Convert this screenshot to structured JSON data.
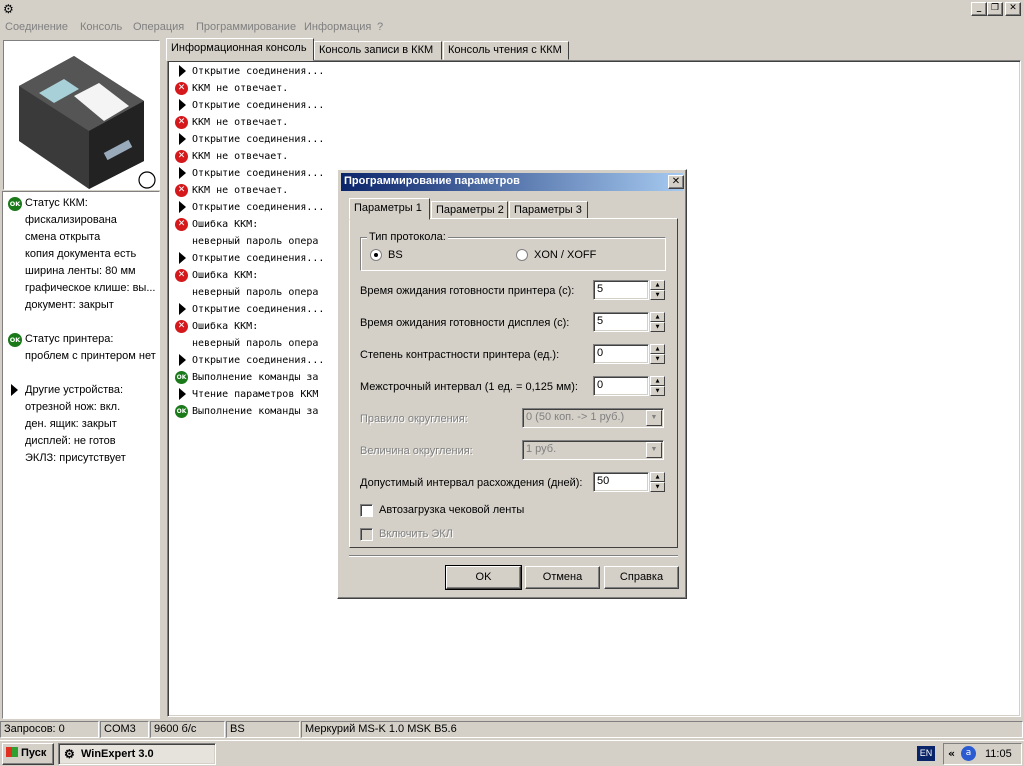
{
  "app": {
    "task_title": "WinExpert 3.0",
    "menu": [
      "Соединение",
      "Консоль",
      "Операция",
      "Программирование",
      "Информация",
      "?"
    ]
  },
  "tabs": [
    {
      "label": "Информационная консоль"
    },
    {
      "label": "Консоль записи в ККМ"
    },
    {
      "label": "Консоль чтения с ККМ"
    }
  ],
  "left_panel": {
    "kkm_status": {
      "title": "Статус ККМ:",
      "lines": [
        "фискализирована",
        "смена открыта",
        "копия документа есть",
        "ширина ленты: 80 мм",
        "графическое клише: вы...",
        "документ: закрыт"
      ]
    },
    "printer_status": {
      "title": "Статус принтера:",
      "lines": [
        "проблем с принтером нет"
      ]
    },
    "other_devices": {
      "title": "Другие устройства:",
      "lines": [
        "отрезной нож: вкл.",
        "ден. ящик: закрыт",
        "дисплей: не готов",
        "ЭКЛЗ: присутствует"
      ]
    }
  },
  "console": [
    {
      "icon": "arrow",
      "text": "Открытие соединения..."
    },
    {
      "icon": "error",
      "text": "ККМ не отвечает."
    },
    {
      "icon": "arrow",
      "text": "Открытие соединения..."
    },
    {
      "icon": "error",
      "text": "ККМ не отвечает."
    },
    {
      "icon": "arrow",
      "text": "Открытие соединения..."
    },
    {
      "icon": "error",
      "text": "ККМ не отвечает."
    },
    {
      "icon": "arrow",
      "text": "Открытие соединения..."
    },
    {
      "icon": "error",
      "text": "ККМ не отвечает."
    },
    {
      "icon": "arrow",
      "text": "Открытие соединения..."
    },
    {
      "icon": "error",
      "text": "Ошибка ККМ:"
    },
    {
      "icon": "none",
      "text": "неверный пароль опера"
    },
    {
      "icon": "arrow",
      "text": "Открытие соединения..."
    },
    {
      "icon": "error",
      "text": "Ошибка ККМ:"
    },
    {
      "icon": "none",
      "text": "неверный пароль опера"
    },
    {
      "icon": "arrow",
      "text": "Открытие соединения..."
    },
    {
      "icon": "error",
      "text": "Ошибка ККМ:"
    },
    {
      "icon": "none",
      "text": "неверный пароль опера"
    },
    {
      "icon": "arrow",
      "text": "Открытие соединения..."
    },
    {
      "icon": "ok",
      "text": "Выполнение команды за"
    },
    {
      "icon": "arrow",
      "text": "Чтение параметров ККМ"
    },
    {
      "icon": "ok",
      "text": "Выполнение команды за"
    }
  ],
  "dialog": {
    "title": "Программирование параметров",
    "tabs": [
      "Параметры 1",
      "Параметры 2",
      "Параметры 3"
    ],
    "protocol_group": "Тип протокола:",
    "radio_bs": "BS",
    "radio_xon": "XON / XOFF",
    "selected_protocol": "BS",
    "fields": [
      {
        "label": "Время ожидания готовности принтера (с):",
        "value": "5"
      },
      {
        "label": "Время ожидания готовности дисплея (с):",
        "value": "5"
      },
      {
        "label": "Степень контрастности принтера (ед.):",
        "value": "0"
      },
      {
        "label": "Межстрочный интервал (1 ед. = 0,125 мм):",
        "value": "0"
      }
    ],
    "rounding_rule_label": "Правило округления:",
    "rounding_rule_value": "0 (50 коп. -> 1 руб.)",
    "rounding_size_label": "Величина округления:",
    "rounding_size_value": "1 руб.",
    "interval_label": "Допустимый интервал расхождения (дней):",
    "interval_value": "50",
    "autoload_label": "Автозагрузка чековой ленты",
    "ekl_label": "Включить ЭКЛ",
    "ok": "OK",
    "cancel": "Отмена",
    "help": "Справка"
  },
  "statusbar": {
    "requests": "Запросов: 0",
    "port": "COM3",
    "baud": "9600 б/с",
    "protocol": "BS",
    "device": "Меркурий MS-K 1.0 MSK B5.6"
  },
  "taskbar": {
    "start": "Пуск",
    "task": "WinExpert 3.0",
    "lang": "EN",
    "clock": "11:05"
  }
}
